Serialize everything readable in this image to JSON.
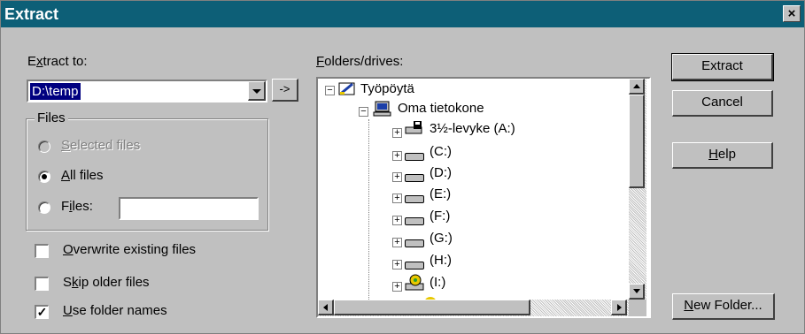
{
  "window": {
    "title": "Extract",
    "close_label": "×"
  },
  "extract_to": {
    "label_pre": "E",
    "label_u": "x",
    "label_post": "tract to:",
    "value": "D:\\temp",
    "go_label": "->"
  },
  "files_group": {
    "legend": "Files",
    "selected_files": {
      "u": "S",
      "rest": "elected files"
    },
    "all_files": {
      "u": "A",
      "rest": "ll files"
    },
    "files": {
      "pre": "F",
      "u": "i",
      "post": "les:"
    },
    "files_value": ""
  },
  "options": {
    "overwrite": {
      "u": "O",
      "rest": "verwrite existing files",
      "checked": false
    },
    "skip_older": {
      "pre": "S",
      "u": "k",
      "post": "ip older files",
      "checked": false
    },
    "use_folder_names": {
      "u": "U",
      "rest": "se folder names",
      "checked": true
    }
  },
  "folders": {
    "label_u": "F",
    "label_rest": "olders/drives:",
    "tree": {
      "desktop": "Työpöytä",
      "computer": "Oma tietokone",
      "drives": [
        "3½-levyke (A:)",
        "(C:)",
        "(D:)",
        "(E:)",
        "(F:)",
        "(G:)",
        "(H:)",
        "(I:)"
      ]
    }
  },
  "buttons": {
    "extract": "Extract",
    "cancel": "Cancel",
    "help_u": "H",
    "help_rest": "elp",
    "new_folder_u": "N",
    "new_folder_rest": "ew Folder..."
  },
  "colors": {
    "title_bar": "#0d5f77",
    "face": "#c0c0c0",
    "selection": "#000080"
  }
}
